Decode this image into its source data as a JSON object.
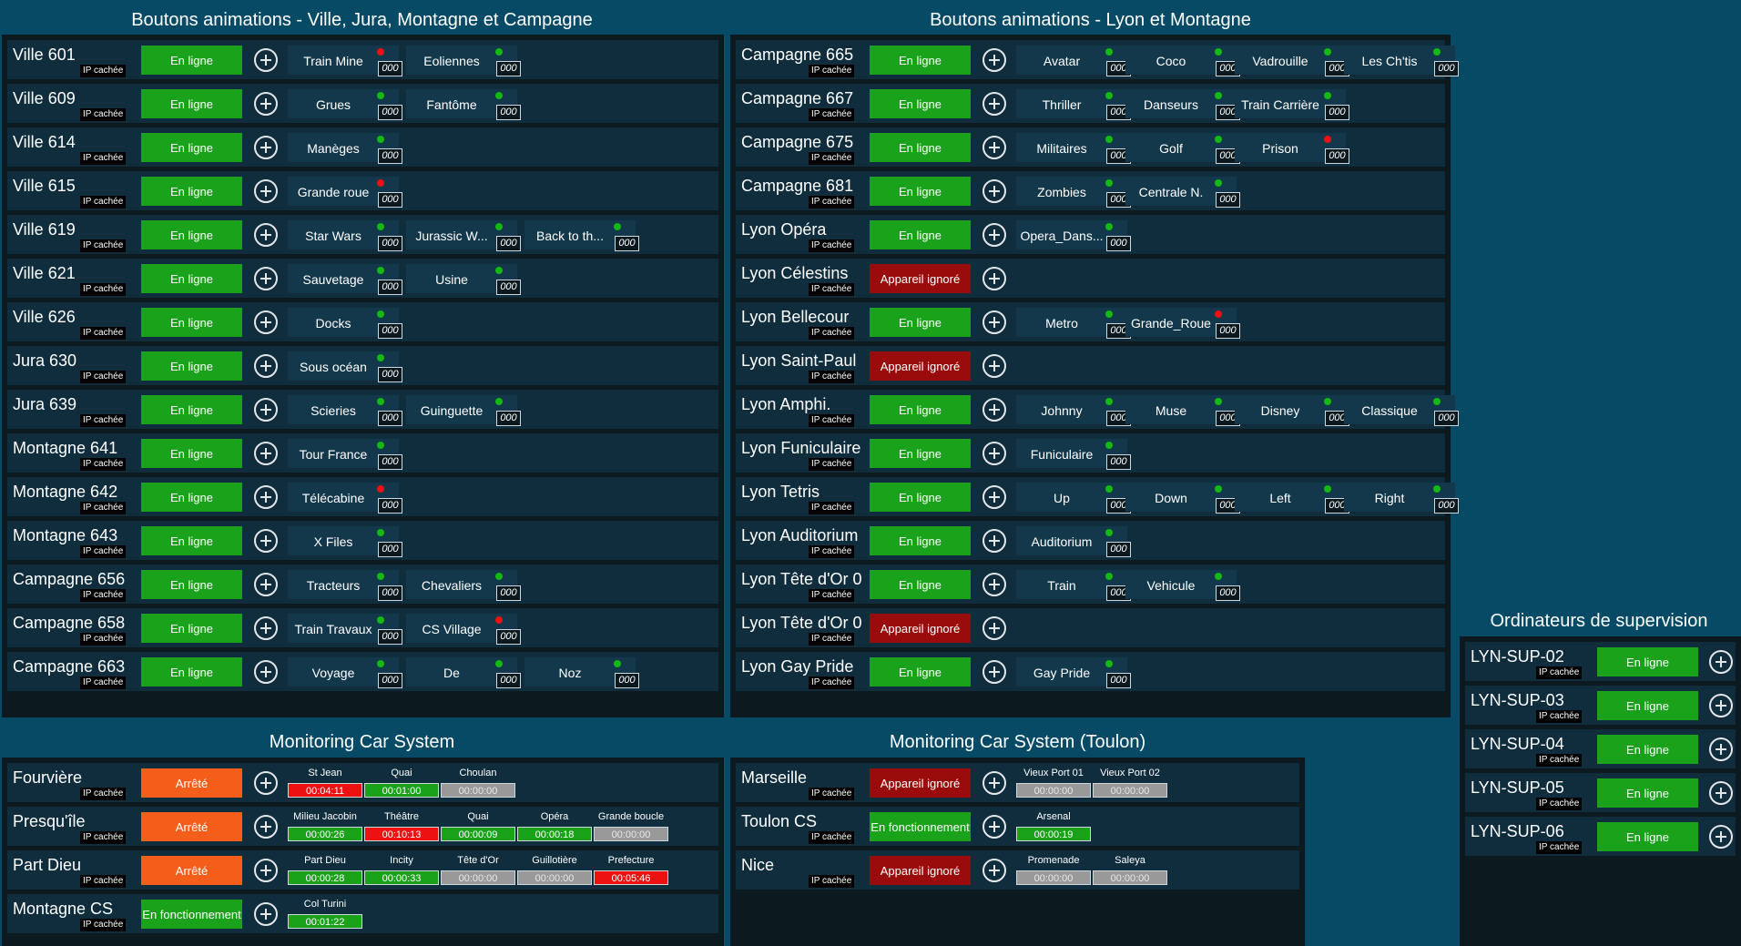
{
  "colors": {
    "background": "#064a66",
    "panel": "#0c1a1f",
    "row": "#0f2d3d",
    "online": "#1ba21b",
    "ignored": "#9a0b0b",
    "stopped": "#f55e1a",
    "indicator_ok": "#13b813",
    "indicator_error": "#ee1111",
    "time_inactive": "#999999"
  },
  "sections": {
    "ville_title": "Boutons animations - Ville, Jura, Montagne et Campagne",
    "lyon_title": "Boutons animations - Lyon et Montagne",
    "supervision_title": "Ordinateurs de supervision",
    "monitoring_title": "Monitoring Car System",
    "toulon_title": "Monitoring Car System (Toulon)"
  },
  "ville": [
    {
      "name": "Ville 601",
      "ip": "IP cachée",
      "status": "En ligne",
      "color": "green",
      "anims": [
        {
          "label": "Train Mine",
          "dot": "r",
          "count": "000"
        },
        {
          "label": "Eoliennes",
          "dot": "g",
          "count": "000"
        }
      ]
    },
    {
      "name": "Ville 609",
      "ip": "IP cachée",
      "status": "En ligne",
      "color": "green",
      "anims": [
        {
          "label": "Grues",
          "dot": "g",
          "count": "000"
        },
        {
          "label": "Fantôme",
          "dot": "g",
          "count": "000"
        }
      ]
    },
    {
      "name": "Ville 614",
      "ip": "IP cachée",
      "status": "En ligne",
      "color": "green",
      "anims": [
        {
          "label": "Manèges",
          "dot": "g",
          "count": "000"
        }
      ]
    },
    {
      "name": "Ville 615",
      "ip": "IP cachée",
      "status": "En ligne",
      "color": "green",
      "anims": [
        {
          "label": "Grande roue",
          "dot": "r",
          "count": "000"
        }
      ]
    },
    {
      "name": "Ville 619",
      "ip": "IP cachée",
      "status": "En ligne",
      "color": "green",
      "anims": [
        {
          "label": "Star Wars",
          "dot": "g",
          "count": "000"
        },
        {
          "label": "Jurassic W...",
          "dot": "g",
          "count": "000"
        },
        {
          "label": "Back to th...",
          "dot": "g",
          "count": "000"
        }
      ]
    },
    {
      "name": "Ville 621",
      "ip": "IP cachée",
      "status": "En ligne",
      "color": "green",
      "anims": [
        {
          "label": "Sauvetage",
          "dot": "g",
          "count": "000"
        },
        {
          "label": "Usine",
          "dot": "g",
          "count": "000"
        }
      ]
    },
    {
      "name": "Ville 626",
      "ip": "IP cachée",
      "status": "En ligne",
      "color": "green",
      "anims": [
        {
          "label": "Docks",
          "dot": "g",
          "count": "000"
        }
      ]
    },
    {
      "name": "Jura 630",
      "ip": "IP cachée",
      "status": "En ligne",
      "color": "green",
      "anims": [
        {
          "label": "Sous océan",
          "dot": "g",
          "count": "000"
        }
      ]
    },
    {
      "name": "Jura 639",
      "ip": "IP cachée",
      "status": "En ligne",
      "color": "green",
      "anims": [
        {
          "label": "Scieries",
          "dot": "g",
          "count": "000"
        },
        {
          "label": "Guinguette",
          "dot": "g",
          "count": "000"
        }
      ]
    },
    {
      "name": "Montagne 641",
      "ip": "IP cachée",
      "status": "En ligne",
      "color": "green",
      "anims": [
        {
          "label": "Tour France",
          "dot": "g",
          "count": "000"
        }
      ]
    },
    {
      "name": "Montagne 642",
      "ip": "IP cachée",
      "status": "En ligne",
      "color": "green",
      "anims": [
        {
          "label": "Télécabine",
          "dot": "r",
          "count": "000"
        }
      ]
    },
    {
      "name": "Montagne 643",
      "ip": "IP cachée",
      "status": "En ligne",
      "color": "green",
      "anims": [
        {
          "label": "X Files",
          "dot": "g",
          "count": "000"
        }
      ]
    },
    {
      "name": "Campagne 656",
      "ip": "IP cachée",
      "status": "En ligne",
      "color": "green",
      "anims": [
        {
          "label": "Tracteurs",
          "dot": "g",
          "count": "000"
        },
        {
          "label": "Chevaliers",
          "dot": "g",
          "count": "000"
        }
      ]
    },
    {
      "name": "Campagne 658",
      "ip": "IP cachée",
      "status": "En ligne",
      "color": "green",
      "anims": [
        {
          "label": "Train Travaux",
          "dot": "g",
          "count": "000"
        },
        {
          "label": "CS Village",
          "dot": "r",
          "count": "000"
        }
      ]
    },
    {
      "name": "Campagne 663",
      "ip": "IP cachée",
      "status": "En ligne",
      "color": "green",
      "anims": [
        {
          "label": "Voyage",
          "dot": "g",
          "count": "000"
        },
        {
          "label": "De",
          "dot": "g",
          "count": "000"
        },
        {
          "label": "Noz",
          "dot": "g",
          "count": "000"
        }
      ]
    }
  ],
  "lyon": [
    {
      "name": "Campagne 665",
      "ip": "IP cachée",
      "status": "En ligne",
      "color": "green",
      "anims": [
        {
          "label": "Avatar",
          "dot": "g",
          "count": "000"
        },
        {
          "label": "Coco",
          "dot": "g",
          "count": "000"
        },
        {
          "label": "Vadrouille",
          "dot": "g",
          "count": "000"
        },
        {
          "label": "Les Ch'tis",
          "dot": "g",
          "count": "000"
        }
      ]
    },
    {
      "name": "Campagne 667",
      "ip": "IP cachée",
      "status": "En ligne",
      "color": "green",
      "anims": [
        {
          "label": "Thriller",
          "dot": "g",
          "count": "000"
        },
        {
          "label": "Danseurs",
          "dot": "g",
          "count": "000"
        },
        {
          "label": "Train Carrière",
          "dot": "g",
          "count": "000"
        }
      ]
    },
    {
      "name": "Campagne 675",
      "ip": "IP cachée",
      "status": "En ligne",
      "color": "green",
      "anims": [
        {
          "label": "Militaires",
          "dot": "g",
          "count": "000"
        },
        {
          "label": "Golf",
          "dot": "g",
          "count": "000"
        },
        {
          "label": "Prison",
          "dot": "r",
          "count": "000"
        }
      ]
    },
    {
      "name": "Campagne 681",
      "ip": "IP cachée",
      "status": "En ligne",
      "color": "green",
      "anims": [
        {
          "label": "Zombies",
          "dot": "g",
          "count": "000"
        },
        {
          "label": "Centrale N.",
          "dot": "g",
          "count": "000"
        }
      ]
    },
    {
      "name": "Lyon Opéra",
      "ip": "IP cachée",
      "status": "En ligne",
      "color": "green",
      "anims": [
        {
          "label": "Opera_Dans...",
          "dot": "g",
          "count": "000"
        }
      ]
    },
    {
      "name": "Lyon Célestins",
      "ip": "IP cachée",
      "status": "Appareil ignoré",
      "color": "red",
      "anims": []
    },
    {
      "name": "Lyon Bellecour",
      "ip": "IP cachée",
      "status": "En ligne",
      "color": "green",
      "anims": [
        {
          "label": "Metro",
          "dot": "g",
          "count": "000"
        },
        {
          "label": "Grande_Roue",
          "dot": "r",
          "count": "000"
        }
      ]
    },
    {
      "name": "Lyon Saint-Paul",
      "ip": "IP cachée",
      "status": "Appareil ignoré",
      "color": "red",
      "anims": []
    },
    {
      "name": "Lyon Amphi.",
      "ip": "IP cachée",
      "status": "En ligne",
      "color": "green",
      "anims": [
        {
          "label": "Johnny",
          "dot": "g",
          "count": "000"
        },
        {
          "label": "Muse",
          "dot": "g",
          "count": "000"
        },
        {
          "label": "Disney",
          "dot": "g",
          "count": "000"
        },
        {
          "label": "Classique",
          "dot": "g",
          "count": "000"
        }
      ]
    },
    {
      "name": "Lyon Funiculaire",
      "ip": "IP cachée",
      "status": "En ligne",
      "color": "green",
      "anims": [
        {
          "label": "Funiculaire",
          "dot": "g",
          "count": "000"
        }
      ]
    },
    {
      "name": "Lyon Tetris",
      "ip": "IP cachée",
      "status": "En ligne",
      "color": "green",
      "anims": [
        {
          "label": "Up",
          "dot": "g",
          "count": "000"
        },
        {
          "label": "Down",
          "dot": "g",
          "count": "000"
        },
        {
          "label": "Left",
          "dot": "g",
          "count": "000"
        },
        {
          "label": "Right",
          "dot": "g",
          "count": "000"
        }
      ]
    },
    {
      "name": "Lyon Auditorium",
      "ip": "IP cachée",
      "status": "En ligne",
      "color": "green",
      "anims": [
        {
          "label": "Auditorium",
          "dot": "g",
          "count": "000"
        }
      ]
    },
    {
      "name": "Lyon Tête d'Or 0",
      "ip": "IP cachée",
      "status": "En ligne",
      "color": "green",
      "anims": [
        {
          "label": "Train",
          "dot": "g",
          "count": "000"
        },
        {
          "label": "Vehicule",
          "dot": "g",
          "count": "000"
        }
      ]
    },
    {
      "name": "Lyon Tête d'Or 0",
      "ip": "IP cachée",
      "status": "Appareil ignoré",
      "color": "red",
      "anims": []
    },
    {
      "name": "Lyon Gay Pride",
      "ip": "IP cachée",
      "status": "En ligne",
      "color": "green",
      "anims": [
        {
          "label": "Gay Pride",
          "dot": "g",
          "count": "000"
        }
      ]
    }
  ],
  "supervision": [
    {
      "name": "LYN-SUP-02",
      "ip": "IP cachée",
      "status": "En ligne",
      "color": "green"
    },
    {
      "name": "LYN-SUP-03",
      "ip": "IP cachée",
      "status": "En ligne",
      "color": "green"
    },
    {
      "name": "LYN-SUP-04",
      "ip": "IP cachée",
      "status": "En ligne",
      "color": "green"
    },
    {
      "name": "LYN-SUP-05",
      "ip": "IP cachée",
      "status": "En ligne",
      "color": "green"
    },
    {
      "name": "LYN-SUP-06",
      "ip": "IP cachée",
      "status": "En ligne",
      "color": "green"
    }
  ],
  "monitoring": [
    {
      "name": "Fourvière",
      "ip": "IP cachée",
      "status": "Arrêté",
      "color": "orange",
      "stops": [
        {
          "label": "St Jean",
          "time": "00:04:11",
          "state": "tr"
        },
        {
          "label": "Quai",
          "time": "00:01:00",
          "state": "tg"
        },
        {
          "label": "Choulan",
          "time": "00:00:00",
          "state": "tgr"
        }
      ]
    },
    {
      "name": "Presqu'île",
      "ip": "IP cachée",
      "status": "Arrêté",
      "color": "orange",
      "stops": [
        {
          "label": "Milieu Jacobin",
          "time": "00:00:26",
          "state": "tg"
        },
        {
          "label": "Théâtre",
          "time": "00:10:13",
          "state": "tr"
        },
        {
          "label": "Quai",
          "time": "00:00:09",
          "state": "tg"
        },
        {
          "label": "Opéra",
          "time": "00:00:18",
          "state": "tg"
        },
        {
          "label": "Grande boucle",
          "time": "00:00:00",
          "state": "tgr"
        }
      ]
    },
    {
      "name": "Part Dieu",
      "ip": "IP cachée",
      "status": "Arrêté",
      "color": "orange",
      "stops": [
        {
          "label": "Part Dieu",
          "time": "00:00:28",
          "state": "tg"
        },
        {
          "label": "Incity",
          "time": "00:00:33",
          "state": "tg"
        },
        {
          "label": "Tête d'Or",
          "time": "00:00:00",
          "state": "tgr"
        },
        {
          "label": "Guillotière",
          "time": "00:00:00",
          "state": "tgr"
        },
        {
          "label": "Prefecture",
          "time": "00:05:46",
          "state": "tr"
        }
      ]
    },
    {
      "name": "Montagne CS",
      "ip": "IP cachée",
      "status": "En fonctionnement",
      "color": "green",
      "stops": [
        {
          "label": "Col Turini",
          "time": "00:01:22",
          "state": "tg"
        }
      ]
    }
  ],
  "toulon": [
    {
      "name": "Marseille",
      "ip": "IP cachée",
      "status": "Appareil ignoré",
      "color": "red",
      "stops": [
        {
          "label": "Vieux Port 01",
          "time": "00:00:00",
          "state": "tgr"
        },
        {
          "label": "Vieux Port 02",
          "time": "00:00:00",
          "state": "tgr"
        }
      ]
    },
    {
      "name": "Toulon CS",
      "ip": "IP cachée",
      "status": "En fonctionnement",
      "color": "green",
      "stops": [
        {
          "label": "Arsenal",
          "time": "00:00:19",
          "state": "tg"
        }
      ]
    },
    {
      "name": "Nice",
      "ip": "IP cachée",
      "status": "Appareil ignoré",
      "color": "red",
      "stops": [
        {
          "label": "Promenade",
          "time": "00:00:00",
          "state": "tgr"
        },
        {
          "label": "Saleya",
          "time": "00:00:00",
          "state": "tgr"
        }
      ]
    }
  ]
}
